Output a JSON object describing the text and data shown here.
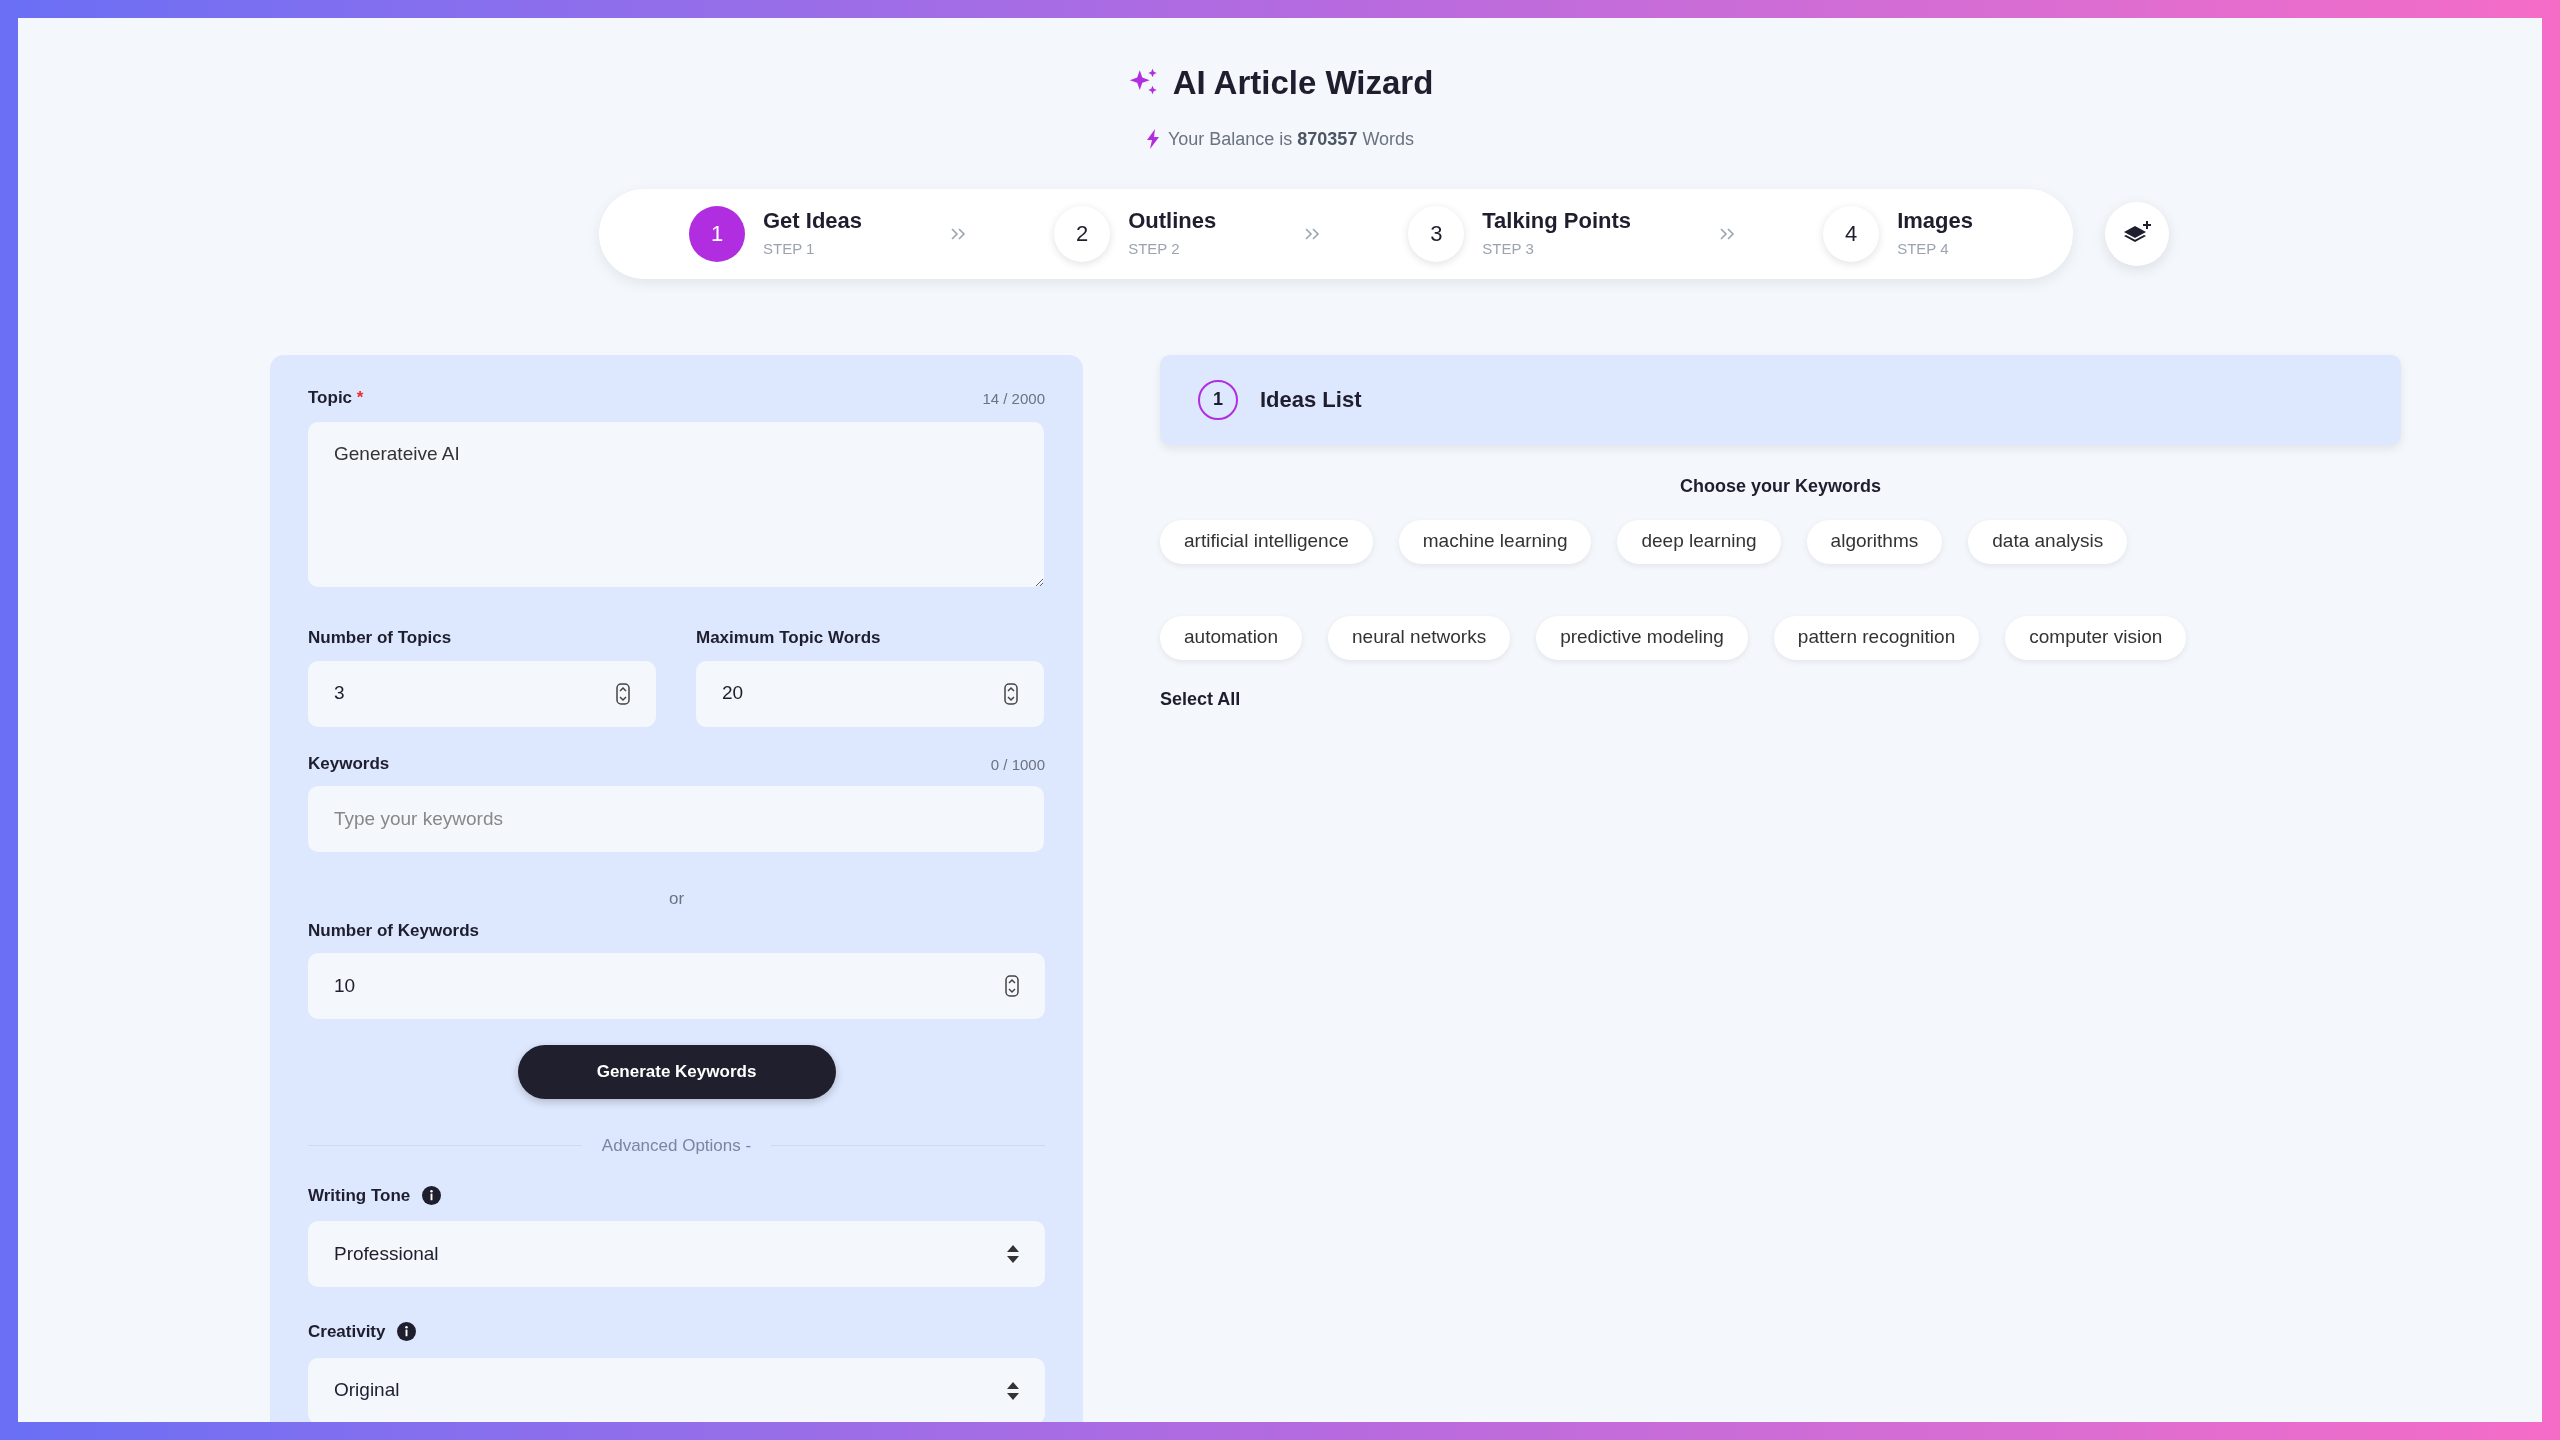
{
  "header": {
    "title": "AI Article Wizard",
    "balance_prefix": "Your Balance is",
    "balance_amount": "870357",
    "balance_suffix": "Words"
  },
  "steps": [
    {
      "number": "1",
      "title": "Get Ideas",
      "subtitle": "STEP 1",
      "selected": true
    },
    {
      "number": "2",
      "title": "Outlines",
      "subtitle": "STEP 2",
      "selected": false
    },
    {
      "number": "3",
      "title": "Talking Points",
      "subtitle": "STEP 3",
      "selected": false
    },
    {
      "number": "4",
      "title": "Images",
      "subtitle": "STEP 4",
      "selected": false
    }
  ],
  "form": {
    "topic": {
      "label": "Topic",
      "required_mark": "*",
      "counter": "14 / 2000",
      "value": "Generateive AI"
    },
    "number_of_topics": {
      "label": "Number of Topics",
      "value": "3"
    },
    "maximum_topic_words": {
      "label": "Maximum Topic Words",
      "value": "20"
    },
    "keywords": {
      "label": "Keywords",
      "counter": "0 / 1000",
      "placeholder": "Type your keywords"
    },
    "separator": "or",
    "number_of_keywords": {
      "label": "Number of Keywords",
      "value": "10"
    },
    "generate_button": "Generate Keywords",
    "advanced_options": "Advanced Options -",
    "writing_tone": {
      "label": "Writing Tone",
      "value": "Professional"
    },
    "creativity": {
      "label": "Creativity",
      "value": "Original"
    }
  },
  "ideas_panel": {
    "number": "1",
    "title": "Ideas List",
    "keywords_heading": "Choose your Keywords",
    "keywords": [
      {
        "label": "artificial intelligence",
        "selected": false
      },
      {
        "label": "machine learning",
        "selected": false
      },
      {
        "label": "deep learning",
        "selected": false
      },
      {
        "label": "algorithms",
        "selected": false
      },
      {
        "label": "data analysis",
        "selected": false
      },
      {
        "label": "automation",
        "selected": false
      },
      {
        "label": "neural networks",
        "selected": false
      },
      {
        "label": "predictive modeling",
        "selected": false
      },
      {
        "label": "pattern recognition",
        "selected": false
      },
      {
        "label": "computer vision",
        "selected": false
      }
    ],
    "select_all": "Select All"
  }
}
